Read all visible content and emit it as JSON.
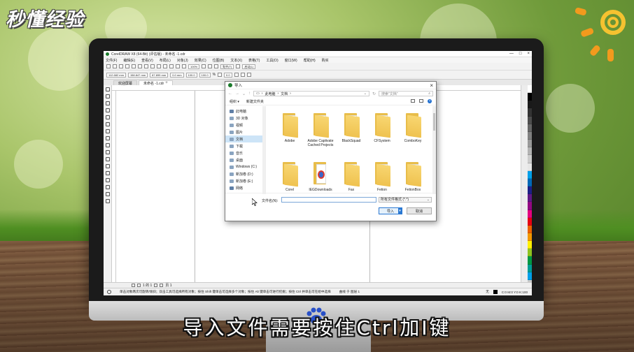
{
  "branding": {
    "logo_text": "秒懂经验"
  },
  "subtitle": "导入文件需要按住Ctrl加I键",
  "app": {
    "title": "CorelDRAW X8 (64-Bit) (评估版) - 未命名 -1.cdr",
    "window_buttons": [
      "—",
      "□",
      "×"
    ],
    "menu": [
      "文件(F)",
      "编辑(E)",
      "查看(V)",
      "布局(L)",
      "对象(J)",
      "效果(C)",
      "位图(B)",
      "文本(X)",
      "表格(T)",
      "工具(O)",
      "窗口(W)",
      "帮助(H)",
      "购买"
    ],
    "toolbar": {
      "zoom": "100%",
      "snap": "贴齐(T)",
      "launch": "启动(L)"
    },
    "propbar": {
      "x": "112.682 mm",
      "y": "158.847 mm",
      "w": "87.899 mm",
      "h": "0.0 mm",
      "sx": "100.0",
      "sy": "100.0",
      "angle": "0.0",
      "unit_pct": "%"
    },
    "tabs": [
      {
        "label": "欢迎屏幕",
        "active": false
      },
      {
        "label": "未命名 -1.cdr",
        "active": true
      }
    ],
    "page_nav": {
      "page_count": "1 的 1",
      "page_tab": "页 1"
    },
    "status": {
      "hint": "单击对象两次可旋转/倾斜；双击工具可选择所有对象；按住 Shift 键单击可选择多个对象；按住 Alt 键单击可进行挖掘；按住 Ctrl 并单击可在组中选择",
      "curve": "曲线 于 图层 1",
      "fill_none": "无",
      "cmyk": "C:0 M:0 Y:0 K:100"
    },
    "palette_colors": [
      "#ffffff",
      "#000000",
      "#1a1a1a",
      "#333333",
      "#4d4d4d",
      "#666666",
      "#808080",
      "#999999",
      "#b3b3b3",
      "#cccccc",
      "#e6e6e6",
      "#00a0e9",
      "#0068b7",
      "#1d2088",
      "#601986",
      "#920783",
      "#e4007f",
      "#e60012",
      "#eb6100",
      "#f39800",
      "#fff100",
      "#8fc31f",
      "#009944",
      "#009e96",
      "#00a0e9",
      "#c9caca"
    ]
  },
  "dialog": {
    "title": "导入",
    "path": [
      "此电脑",
      "文档"
    ],
    "search_placeholder": "搜索\"文档\"",
    "organize": "组织 ▾",
    "new_folder": "新建文件夹",
    "nav_items": [
      {
        "label": "此电脑",
        "selected": false
      },
      {
        "label": "3D 对象",
        "selected": false
      },
      {
        "label": "视频",
        "selected": false
      },
      {
        "label": "图片",
        "selected": false
      },
      {
        "label": "文档",
        "selected": true
      },
      {
        "label": "下载",
        "selected": false
      },
      {
        "label": "音乐",
        "selected": false
      },
      {
        "label": "桌面",
        "selected": false
      },
      {
        "label": "Windows (C:)",
        "selected": false
      },
      {
        "label": "新加卷 (D:)",
        "selected": false
      },
      {
        "label": "新加卷 (E:)",
        "selected": false
      },
      {
        "label": "网络",
        "selected": false
      }
    ],
    "files": [
      {
        "name": "Adobe",
        "special": false
      },
      {
        "name": "Adobe Captivate Cached Projects",
        "special": false
      },
      {
        "name": "BlackSquad",
        "special": false
      },
      {
        "name": "CFSystem",
        "special": false
      },
      {
        "name": "ComboKey",
        "special": false
      },
      {
        "name": "Corel",
        "special": false
      },
      {
        "name": "IEGDownloads",
        "special": true
      },
      {
        "name": "Fax",
        "special": false
      },
      {
        "name": "Fetion",
        "special": false
      },
      {
        "name": "FetionBox",
        "special": false
      }
    ],
    "filename_label": "文件名(N):",
    "filetype": "所有文件格式 (*.*)",
    "import_button": "导入",
    "cancel_button": "取消"
  }
}
